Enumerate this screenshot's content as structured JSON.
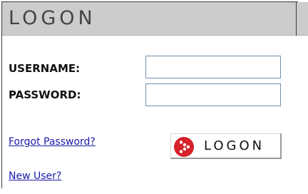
{
  "header": {
    "title": "LOGON"
  },
  "form": {
    "username_label": "USERNAME:",
    "password_label": "PASSWORD:",
    "username_value": "",
    "password_value": ""
  },
  "links": {
    "forgot_password": "Forgot Password?",
    "new_user": "New User?"
  },
  "logon_button": {
    "label": "LOGON",
    "icon": "play-arrow-icon"
  },
  "colors": {
    "header_bg": "#cccccc",
    "header_text": "#444444",
    "link": "#1a1aa8",
    "icon_red": "#d6202a",
    "input_border": "#6f90b0"
  }
}
